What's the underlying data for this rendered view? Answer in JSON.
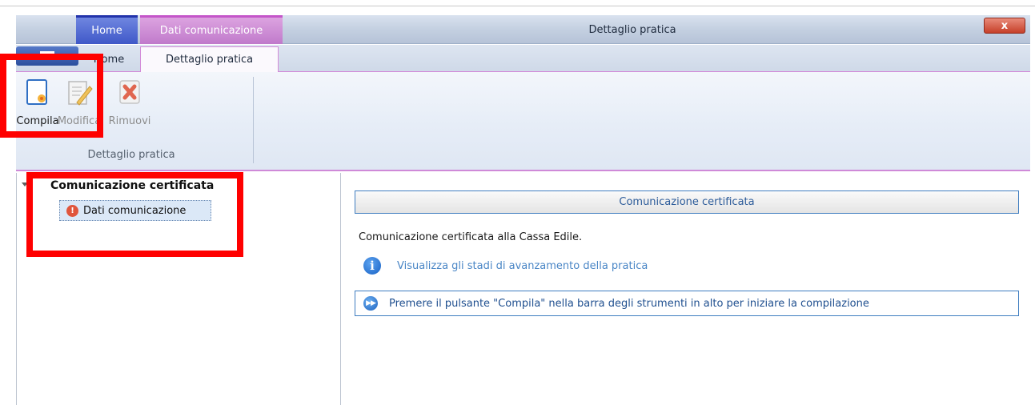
{
  "window": {
    "title": "Dettaglio pratica",
    "close_label": "x"
  },
  "context_tabs": {
    "home": "Home",
    "dati": "Dati comunicazione"
  },
  "tabs": {
    "home": "Home",
    "active": "Dettaglio pratica"
  },
  "ribbon": {
    "compila": "Compila",
    "modifica": "Modifica",
    "rimuovi": "Rimuovi",
    "group_label": "Dettaglio pratica"
  },
  "tree": {
    "root": "Comunicazione certificata",
    "node": "Dati comunicazione",
    "node_icon": "warning-icon"
  },
  "main": {
    "header": "Comunicazione certificata",
    "description": "Comunicazione certificata alla Cassa Edile.",
    "link": "Visualizza gli stadi di avanzamento della pratica",
    "hint": "Premere il pulsante \"Compila\" nella barra degli strumenti in alto per iniziare la compilazione"
  },
  "colors": {
    "accent_blue": "#3f7dc0",
    "context_home": "#3f58c8",
    "context_dati": "#c07acb",
    "highlight": "#ff0000"
  }
}
